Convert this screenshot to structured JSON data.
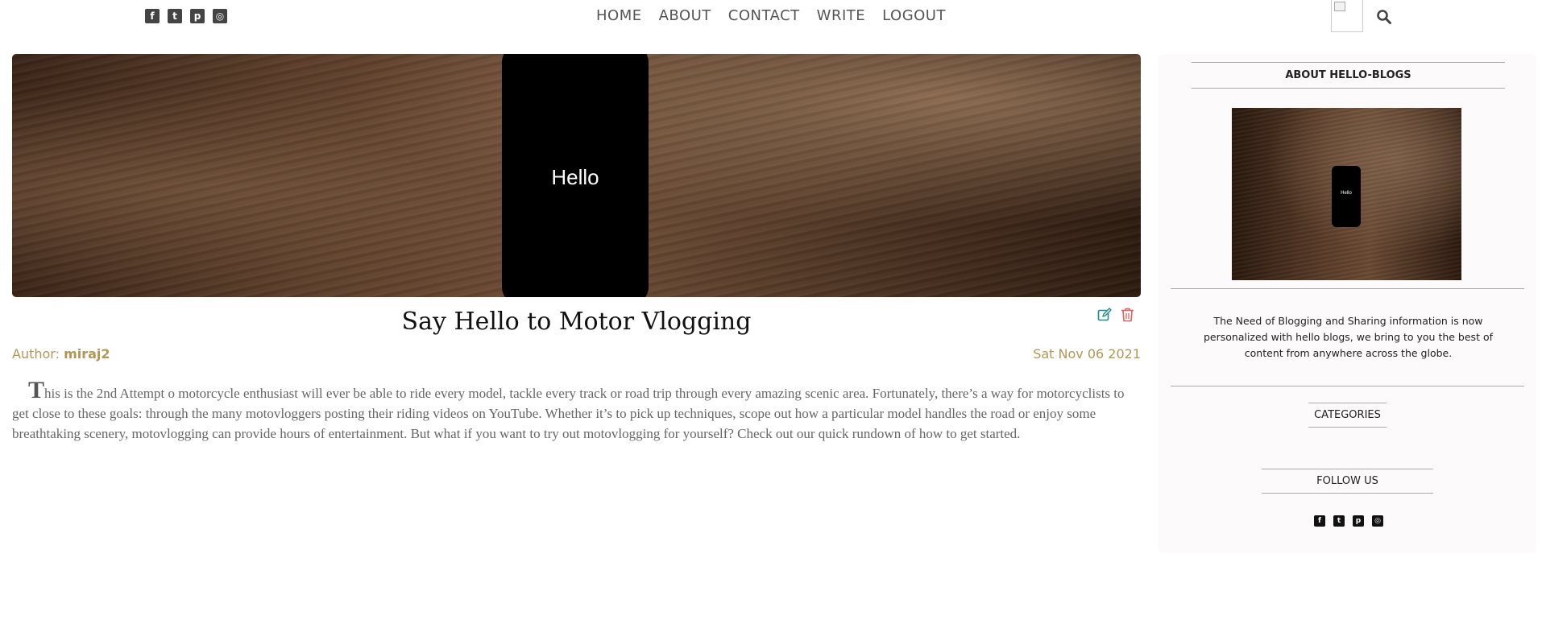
{
  "topbar": {
    "social": [
      {
        "icon": "facebook-square-icon",
        "glyph": "f"
      },
      {
        "icon": "twitter-square-icon",
        "glyph": "t"
      },
      {
        "icon": "pinterest-square-icon",
        "glyph": "p"
      },
      {
        "icon": "instagram-square-icon",
        "glyph": "◎"
      }
    ],
    "nav": {
      "home": "HOME",
      "about": "ABOUT",
      "contact": "CONTACT",
      "write": "WRITE",
      "logout": "LOGOUT"
    },
    "search_icon": "search-icon"
  },
  "post": {
    "hero_text": "Hello",
    "title": "Say Hello to Motor Vlogging",
    "author_label": "Author: ",
    "author": "miraj2",
    "date": "Sat Nov 06 2021",
    "body_first_letter": "T",
    "body_rest": "his is the 2nd Attempt o motorcycle enthusiast will ever be able to ride every model, tackle every track or road trip through every amazing scenic area. Fortunately, there’s a way for motorcyclists to get close to these goals: through the many motovloggers posting their riding videos on YouTube. Whether it’s to pick up techniques, scope out how a particular model handles the road or enjoy some breathtaking scenery, motovlogging can provide hours of entertainment. But what if you want to try out motovlogging for yourself? Check out our quick rundown of how to get started.",
    "edit_icon_color": "#1f8a8a",
    "trash_icon_color": "#e06060"
  },
  "sidebar": {
    "about_title": "ABOUT HELLO-BLOGS",
    "about_image_text": "Hello",
    "about_desc": "The Need of Blogging and Sharing information is now personalized with hello blogs, we bring to you the best of content from anywhere across the globe.",
    "categories_title": "CATEGORIES",
    "follow_title": "FOLLOW US"
  },
  "colors": {
    "accent_gold": "#b39656",
    "text_gray": "#666666"
  }
}
